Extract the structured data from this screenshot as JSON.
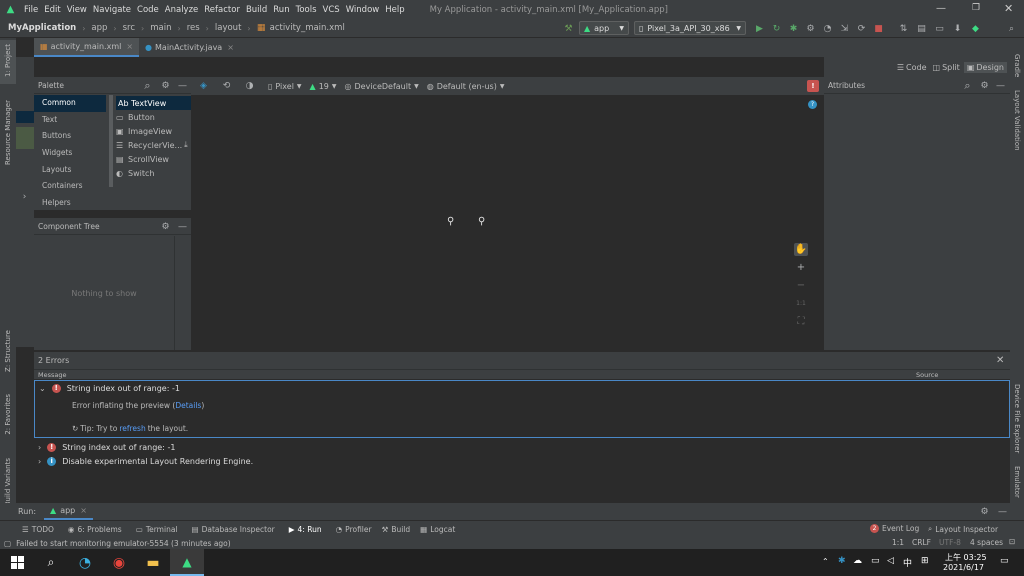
{
  "menu": {
    "items": [
      "File",
      "Edit",
      "View",
      "Navigate",
      "Code",
      "Analyze",
      "Refactor",
      "Build",
      "Run",
      "Tools",
      "VCS",
      "Window",
      "Help"
    ],
    "window_title": "My Application - activity_main.xml [My_Application.app]"
  },
  "breadcrumb": [
    "MyApplication",
    "app",
    "src",
    "main",
    "res",
    "layout",
    "activity_main.xml"
  ],
  "run_config": "app",
  "device": "Pixel_3a_API_30_x86",
  "editor_tabs": [
    "activity_main.xml",
    "MainActivity.java"
  ],
  "view_modes": [
    "Code",
    "Split",
    "Design"
  ],
  "left_tools": [
    "1: Project",
    "Resource Manager",
    "Z: Structure",
    "2: Favorites",
    "Build Variants"
  ],
  "right_tools": [
    "Gradle",
    "Layout Validation",
    "Device File Explorer",
    "Emulator"
  ],
  "palette": {
    "title": "Palette",
    "categories": [
      "Common",
      "Text",
      "Buttons",
      "Widgets",
      "Layouts",
      "Containers",
      "Helpers"
    ],
    "widgets": [
      "Ab TextView",
      "Button",
      "ImageView",
      "RecyclerVie...",
      "ScrollView",
      "Switch"
    ]
  },
  "component_tree": {
    "title": "Component Tree",
    "empty": "Nothing to show"
  },
  "design_toolbar": {
    "device": "Pixel",
    "api": "19",
    "theme": "DeviceDefault",
    "locale": "Default (en-us)"
  },
  "zoom": {
    "ratio": "1:1"
  },
  "attributes": {
    "title": "Attributes"
  },
  "errors": {
    "title": "2 Errors",
    "col_message": "Message",
    "col_source": "Source",
    "items": [
      {
        "text": "String index out of range: -1",
        "kind": "error",
        "expanded": true
      },
      {
        "text": "String index out of range: -1",
        "kind": "error",
        "expanded": false
      },
      {
        "text": "Disable experimental Layout Rendering Engine.",
        "kind": "info",
        "expanded": false
      }
    ],
    "detail": {
      "line": "Error inflating the preview (",
      "link": "Details",
      "close": ")",
      "tip_prefix": "Tip: Try to ",
      "tip_link": "refresh",
      "tip_suffix": " the layout."
    }
  },
  "run": {
    "label": "Run:",
    "config": "app"
  },
  "tool_windows": [
    "TODO",
    "6: Problems",
    "Terminal",
    "Database Inspector",
    "4: Run",
    "Profiler",
    "Build",
    "Logcat"
  ],
  "tool_windows_right": [
    {
      "count": "2",
      "label": "Event Log"
    },
    {
      "label": "Layout Inspector"
    }
  ],
  "status": {
    "message": "Failed to start monitoring emulator-5554 (3 minutes ago)",
    "position": "1:1",
    "line_sep": "CRLF",
    "encoding": "UTF-8",
    "indent": "4 spaces"
  },
  "taskbar": {
    "time": "上午 03:25",
    "date": "2021/6/17",
    "ime": "中"
  },
  "colors": {
    "error": "#c75450",
    "info": "#3592c4",
    "link": "#589df6",
    "android_green": "#3ddc84"
  }
}
